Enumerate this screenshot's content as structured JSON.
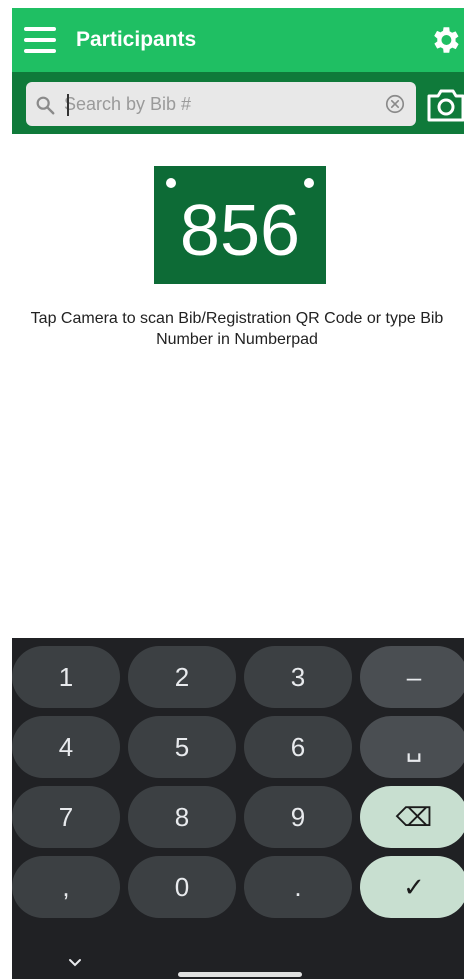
{
  "appbar": {
    "title": "Participants"
  },
  "search": {
    "placeholder": "Search by Bib #"
  },
  "bib": {
    "number": "856"
  },
  "hint": {
    "line1": "Tap Camera to scan Bib/Registration QR Code or type Bib",
    "line2": "Number in Numberpad"
  },
  "keyboard": {
    "keys": [
      "1",
      "2",
      "3",
      "–",
      "4",
      "5",
      "6",
      "␣",
      "7",
      "8",
      "9",
      "⌫",
      ",",
      "0",
      ".",
      "✓"
    ]
  },
  "colors": {
    "appbar": "#1fbf63",
    "searchbar": "#0f7a3a",
    "bib": "#0d6b36",
    "keyboard": "#202124"
  },
  "icons": [
    "menu-icon",
    "gear-icon",
    "search-icon",
    "clear-icon",
    "camera-icon",
    "chevron-down-icon"
  ]
}
